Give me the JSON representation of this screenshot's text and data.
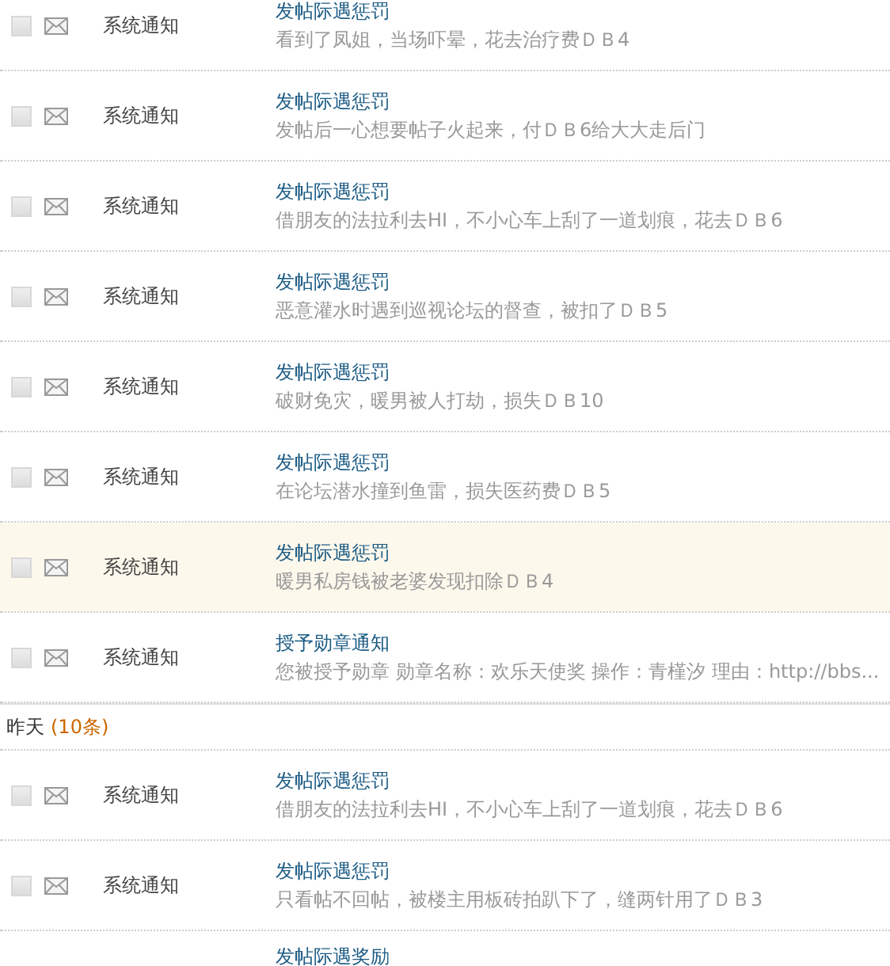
{
  "groups": [
    {
      "rows": [
        {
          "sender": "系统通知",
          "title": "发帖际遇惩罚",
          "summary": "看到了凤姐，当场吓晕，花去治疗费ＤＢ4",
          "checked": false,
          "highlighted": false
        },
        {
          "sender": "系统通知",
          "title": "发帖际遇惩罚",
          "summary": "发帖后一心想要帖子火起来，付ＤＢ6给大大走后门",
          "checked": false,
          "highlighted": false
        },
        {
          "sender": "系统通知",
          "title": "发帖际遇惩罚",
          "summary": "借朋友的法拉利去HI，不小心车上刮了一道划痕，花去ＤＢ6",
          "checked": false,
          "highlighted": false
        },
        {
          "sender": "系统通知",
          "title": "发帖际遇惩罚",
          "summary": "恶意灌水时遇到巡视论坛的督查，被扣了ＤＢ5",
          "checked": false,
          "highlighted": false
        },
        {
          "sender": "系统通知",
          "title": "发帖际遇惩罚",
          "summary": "破财免灾，暖男被人打劫，损失ＤＢ10",
          "checked": false,
          "highlighted": false
        },
        {
          "sender": "系统通知",
          "title": "发帖际遇惩罚",
          "summary": "在论坛潜水撞到鱼雷，损失医药费ＤＢ5",
          "checked": false,
          "highlighted": false
        },
        {
          "sender": "系统通知",
          "title": "发帖际遇惩罚",
          "summary": "暖男私房钱被老婆发现扣除ＤＢ4",
          "checked": false,
          "highlighted": true
        },
        {
          "sender": "系统通知",
          "title": "授予勋章通知",
          "summary": "您被授予勋章 勋章名称：欢乐天使奖 操作：青槿汐 理由：http://bbs...",
          "checked": false,
          "highlighted": false
        }
      ]
    },
    {
      "heading": "昨天",
      "count": "(10条)",
      "rows": [
        {
          "sender": "系统通知",
          "title": "发帖际遇惩罚",
          "summary": "借朋友的法拉利去HI，不小心车上刮了一道划痕，花去ＤＢ6",
          "checked": false,
          "highlighted": false
        },
        {
          "sender": "系统通知",
          "title": "发帖际遇惩罚",
          "summary": "只看帖不回帖，被楼主用板砖拍趴下了，缝两针用了ＤＢ3",
          "checked": false,
          "highlighted": false
        },
        {
          "title": "发帖际遇奖励"
        }
      ]
    }
  ]
}
